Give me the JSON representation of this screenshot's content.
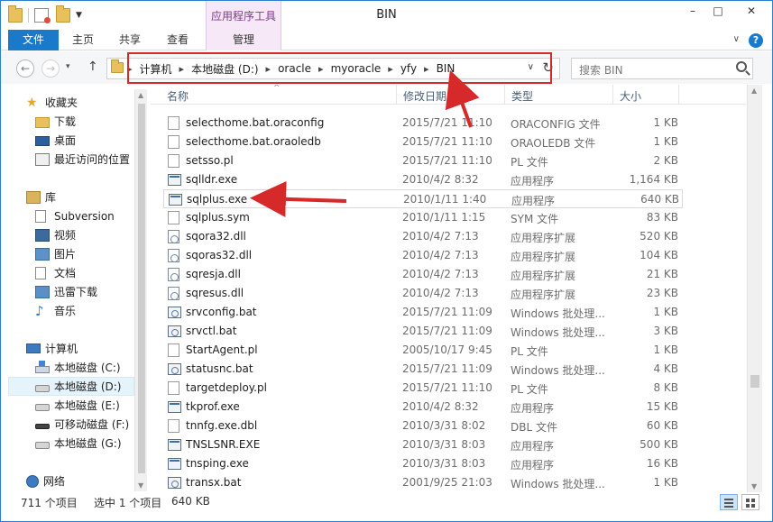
{
  "window": {
    "title": "BIN",
    "context_tab_title": "应用程序工具",
    "buttons": {
      "minimize": "–",
      "maximize": "□",
      "close": "✕"
    }
  },
  "ribbon": {
    "tabs": [
      {
        "label": "文件"
      },
      {
        "label": "主页"
      },
      {
        "label": "共享"
      },
      {
        "label": "查看"
      },
      {
        "label": "管理"
      }
    ],
    "help": "?"
  },
  "navbar": {
    "back": "←",
    "forward": "→",
    "up": "↑",
    "breadcrumbs": [
      "计算机",
      "本地磁盘 (D:)",
      "oracle",
      "myoracle",
      "yfy",
      "BIN"
    ],
    "search_placeholder": "搜索 BIN"
  },
  "sidebar": {
    "favorites": {
      "label": "收藏夹",
      "items": [
        "下载",
        "桌面",
        "最近访问的位置"
      ]
    },
    "libraries": {
      "label": "库",
      "items": [
        "Subversion",
        "视频",
        "图片",
        "文档",
        "迅雷下载",
        "音乐"
      ]
    },
    "computer": {
      "label": "计算机",
      "items": [
        "本地磁盘 (C:)",
        "本地磁盘 (D:)",
        "本地磁盘 (E:)",
        "可移动磁盘 (F:)",
        "本地磁盘 (G:)"
      ]
    },
    "network": {
      "label": "网络"
    }
  },
  "columns": {
    "name": "名称",
    "date": "修改日期",
    "type": "类型",
    "size": "大小"
  },
  "files": [
    {
      "name": "selecthome.bat.oraconfig",
      "date": "2015/7/21 11:10",
      "type": "ORACONFIG 文件",
      "size": "1 KB",
      "icon": "file"
    },
    {
      "name": "selecthome.bat.oraoledb",
      "date": "2015/7/21 11:10",
      "type": "ORAOLEDB 文件",
      "size": "1 KB",
      "icon": "file"
    },
    {
      "name": "setsso.pl",
      "date": "2015/7/21 11:10",
      "type": "PL 文件",
      "size": "2 KB",
      "icon": "file"
    },
    {
      "name": "sqlldr.exe",
      "date": "2010/4/2 8:32",
      "type": "应用程序",
      "size": "1,164 KB",
      "icon": "exe"
    },
    {
      "name": "sqlplus.exe",
      "date": "2010/1/11 1:40",
      "type": "应用程序",
      "size": "640 KB",
      "icon": "exe"
    },
    {
      "name": "sqlplus.sym",
      "date": "2010/1/11 1:15",
      "type": "SYM 文件",
      "size": "83 KB",
      "icon": "file"
    },
    {
      "name": "sqora32.dll",
      "date": "2010/4/2 7:13",
      "type": "应用程序扩展",
      "size": "520 KB",
      "icon": "dll"
    },
    {
      "name": "sqoras32.dll",
      "date": "2010/4/2 7:13",
      "type": "应用程序扩展",
      "size": "104 KB",
      "icon": "dll"
    },
    {
      "name": "sqresja.dll",
      "date": "2010/4/2 7:13",
      "type": "应用程序扩展",
      "size": "21 KB",
      "icon": "dll"
    },
    {
      "name": "sqresus.dll",
      "date": "2010/4/2 7:13",
      "type": "应用程序扩展",
      "size": "23 KB",
      "icon": "dll"
    },
    {
      "name": "srvconfig.bat",
      "date": "2015/7/21 11:09",
      "type": "Windows 批处理...",
      "size": "1 KB",
      "icon": "bat"
    },
    {
      "name": "srvctl.bat",
      "date": "2015/7/21 11:09",
      "type": "Windows 批处理...",
      "size": "3 KB",
      "icon": "bat"
    },
    {
      "name": "StartAgent.pl",
      "date": "2005/10/17 9:45",
      "type": "PL 文件",
      "size": "1 KB",
      "icon": "file"
    },
    {
      "name": "statusnc.bat",
      "date": "2015/7/21 11:09",
      "type": "Windows 批处理...",
      "size": "4 KB",
      "icon": "bat"
    },
    {
      "name": "targetdeploy.pl",
      "date": "2015/7/21 11:10",
      "type": "PL 文件",
      "size": "8 KB",
      "icon": "file"
    },
    {
      "name": "tkprof.exe",
      "date": "2010/4/2 8:32",
      "type": "应用程序",
      "size": "15 KB",
      "icon": "exe"
    },
    {
      "name": "tnnfg.exe.dbl",
      "date": "2010/3/31 8:02",
      "type": "DBL 文件",
      "size": "60 KB",
      "icon": "file"
    },
    {
      "name": "TNSLSNR.EXE",
      "date": "2010/3/31 8:03",
      "type": "应用程序",
      "size": "500 KB",
      "icon": "exe"
    },
    {
      "name": "tnsping.exe",
      "date": "2010/3/31 8:03",
      "type": "应用程序",
      "size": "16 KB",
      "icon": "exe"
    },
    {
      "name": "transx.bat",
      "date": "2001/9/25 21:03",
      "type": "Windows 批处理...",
      "size": "1 KB",
      "icon": "bat"
    }
  ],
  "status": {
    "item_count": "711 个项目",
    "selected": "选中 1 个项目",
    "selected_size": "640 KB"
  },
  "colors": {
    "accent": "#1979ca",
    "context_tab": "#f6e8f7",
    "annotation_red": "#d62a2a",
    "selection": "#e5f3fb"
  }
}
